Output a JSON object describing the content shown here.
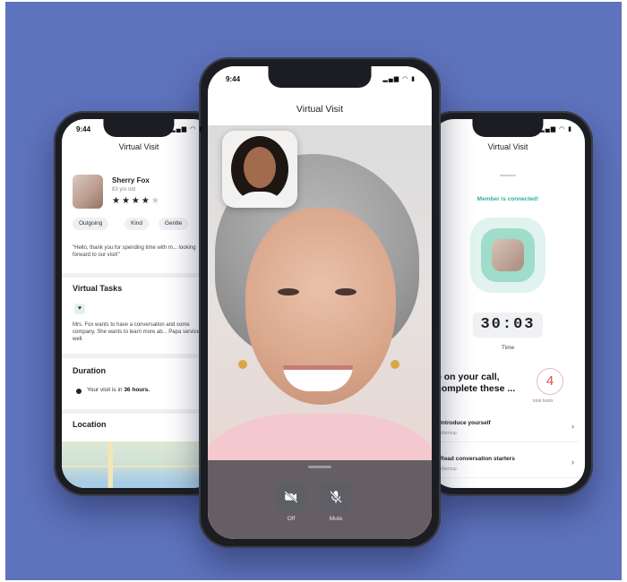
{
  "status": {
    "time": "9:44",
    "icons": "▂▄▆ ◠ ▮"
  },
  "left_screen": {
    "title": "Virtual Visit",
    "member": {
      "name": "Sherry Fox",
      "age": "83 yrs old",
      "stars": "★★★★",
      "star_off": "★"
    },
    "tags": [
      "Outgoing",
      "Kind",
      "Gentle"
    ],
    "quote": "\"Hello, thank you for spending time with m... looking forward to our visit!\"",
    "tasks_title": "Virtual Tasks",
    "task_icon": "♥",
    "task_text": "Mrs. Fox wants to have a conversation and some company. She wants to learn more ab... Papa service as well.",
    "duration_title": "Duration",
    "visit_text_pre": "Your visit is in",
    "visit_hours": "36 hours.",
    "location_title": "Location"
  },
  "center_screen": {
    "title": "Virtual Visit",
    "controls": [
      {
        "label": "Off",
        "icon": "video-off-icon"
      },
      {
        "label": "Mute",
        "icon": "mic-off-icon"
      }
    ]
  },
  "right_screen": {
    "title": "Virtual Visit",
    "connected": "Member is connected!",
    "timer": "30:03",
    "timer_label": "Time",
    "heading": "e on your call, complete these ...",
    "count": "4",
    "count_label": "total tasks",
    "tasks": [
      {
        "title": "Introduce yourself",
        "sub": "Warmup"
      },
      {
        "title": "Read conversation starters",
        "sub": "Warmup"
      }
    ]
  },
  "colors": {
    "background": "#5e73bd",
    "accent": "#27b39b",
    "count": "#e04c4c"
  }
}
